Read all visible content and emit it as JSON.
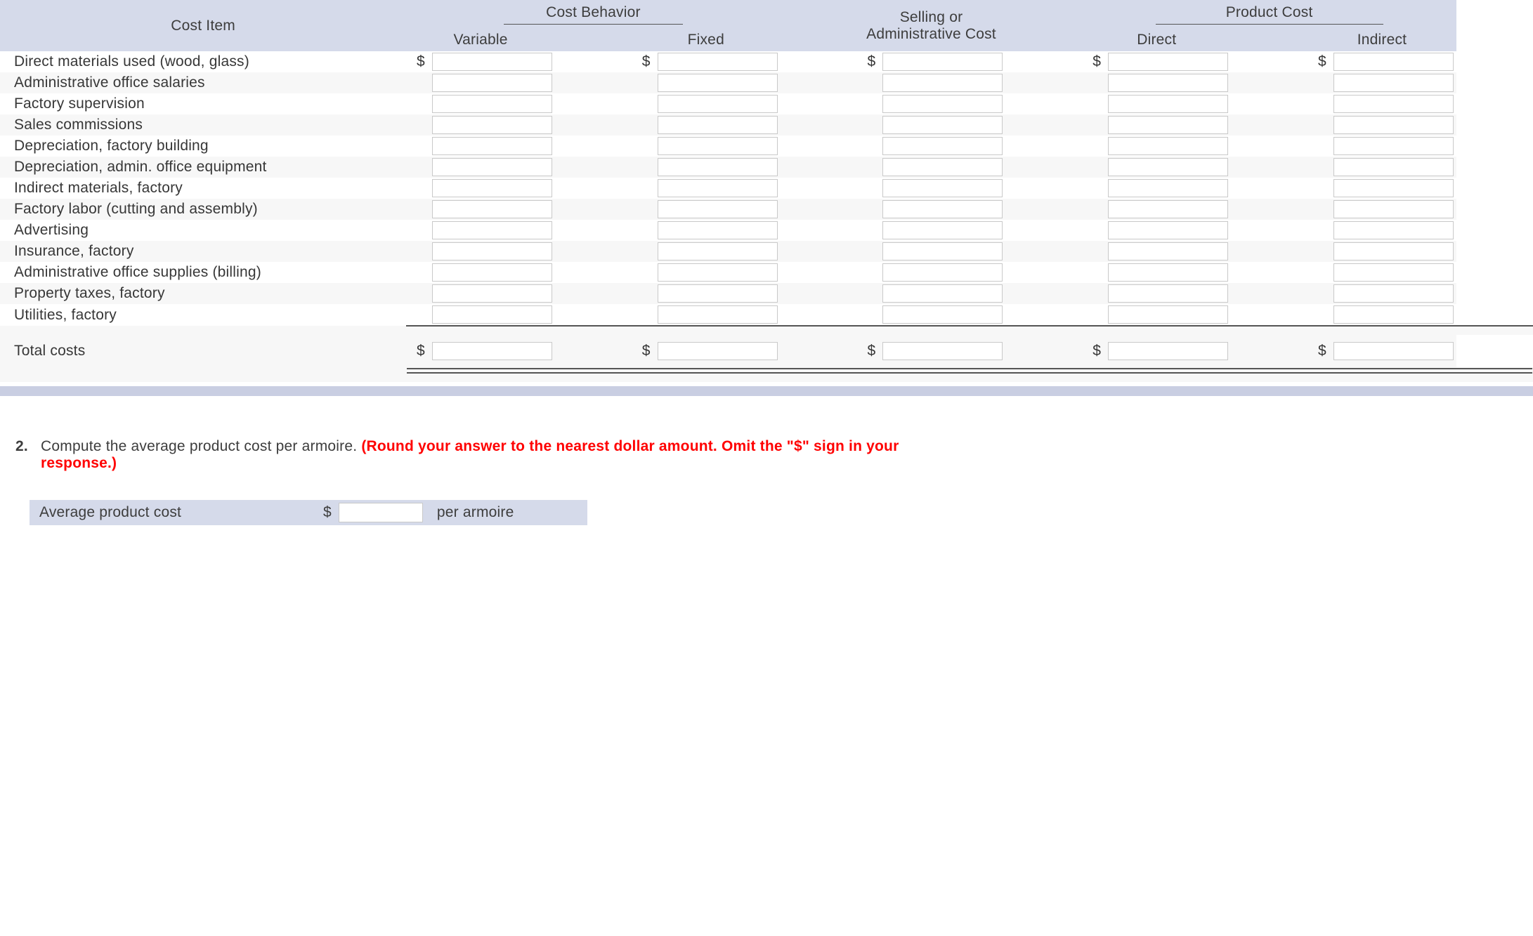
{
  "table": {
    "headers": {
      "cost_item": "Cost Item",
      "group_behavior": "Cost Behavior",
      "group_selling": "Selling or Administrative Cost",
      "group_product": "Product Cost",
      "variable": "Variable",
      "fixed": "Fixed",
      "direct": "Direct",
      "indirect": "Indirect"
    },
    "dollar": "$",
    "rows": [
      {
        "label": "Direct materials used (wood, glass)",
        "show_dollar": true
      },
      {
        "label": "Administrative office salaries",
        "show_dollar": false
      },
      {
        "label": "Factory supervision",
        "show_dollar": false
      },
      {
        "label": "Sales commissions",
        "show_dollar": false
      },
      {
        "label": "Depreciation, factory building",
        "show_dollar": false
      },
      {
        "label": "Depreciation, admin. office equipment",
        "show_dollar": false
      },
      {
        "label": "Indirect materials, factory",
        "show_dollar": false
      },
      {
        "label": "Factory labor (cutting and assembly)",
        "show_dollar": false
      },
      {
        "label": "Advertising",
        "show_dollar": false
      },
      {
        "label": "Insurance, factory",
        "show_dollar": false
      },
      {
        "label": "Administrative office supplies (billing)",
        "show_dollar": false
      },
      {
        "label": "Property taxes, factory",
        "show_dollar": false
      },
      {
        "label": "Utilities, factory",
        "show_dollar": false
      }
    ],
    "totals_label": "Total costs"
  },
  "question2": {
    "number": "2.",
    "text": "Compute the average product cost per armoire. ",
    "bold_red": "(Round your answer to the nearest dollar amount. Omit the \"$\" sign in your response.)"
  },
  "answer": {
    "label": "Average product cost",
    "dollar": "$",
    "unit": "per armoire"
  }
}
